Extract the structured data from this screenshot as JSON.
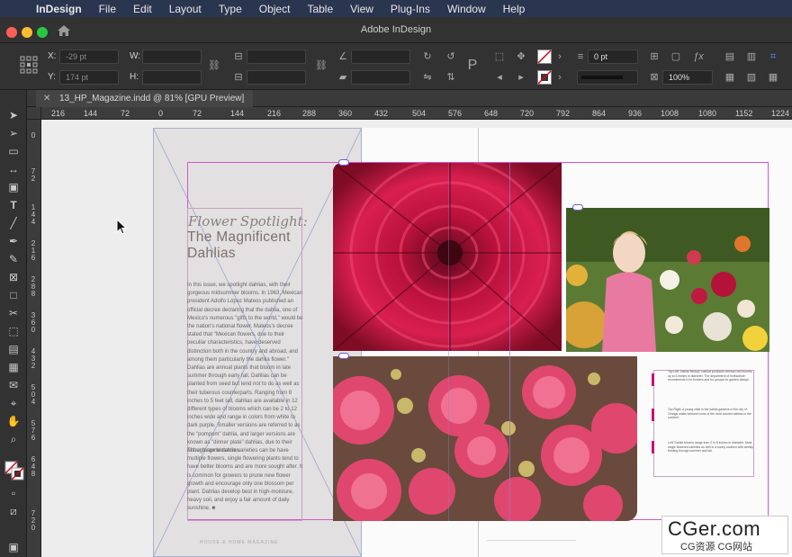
{
  "menubar": {
    "app": "InDesign",
    "items": [
      "File",
      "Edit",
      "Layout",
      "Type",
      "Object",
      "Table",
      "View",
      "Plug-Ins",
      "Window",
      "Help"
    ]
  },
  "window": {
    "title": "Adobe InDesign"
  },
  "control": {
    "x_label": "X:",
    "x_value": "-29 pt",
    "y_label": "Y:",
    "y_value": "174 pt",
    "w_label": "W:",
    "h_label": "H:",
    "stroke_weight": "0 pt",
    "zoom": "100%"
  },
  "document": {
    "tab_title": "13_HP_Magazine.indd @ 81% [GPU Preview]"
  },
  "ruler": {
    "horizontal": [
      "216",
      "144",
      "72",
      "0",
      "72",
      "144",
      "216",
      "288",
      "360",
      "432",
      "504",
      "576",
      "648",
      "720",
      "792",
      "864",
      "936",
      "1008",
      "1080",
      "1152",
      "1224"
    ],
    "vertical": [
      "0",
      "7 2",
      "1 4 4",
      "2 1 6",
      "2 8 8",
      "3 6 0",
      "4 3 2",
      "5 0 4",
      "5 7 6",
      "6 4 8",
      "7 2 0"
    ]
  },
  "article": {
    "kicker": "Flower Spotlight:",
    "title_line1": "The Magnificent",
    "title_line2": "Dahlias",
    "para1": "In this issue, we spotlight dahlias, with their gorgeous midsummer blooms. In 1963, Mexican president Adolfo López Mateos published an official decree declaring that the dahlia, one of Mexico's numerous \"gifts to the world,\" would be the nation's national flower. Mateos's decree stated that \"Mexican flowers, due to their peculiar characteristics, have deserved distinction both in the country and abroad, and among them particularly the dahlia flower.\"",
    "para2": "Dahlias are annual plants that bloom in late summer through early fall. Dahlias can be planted from seed but tend not to do as well as their tuberous counterparts. Ranging from 8 inches to 5 feet tall, dahlias are available in 12 different types of blooms which can be 2 to 12 inches wide and range in colors from white to dark purple. Smaller versions are referred to as the \"pompom\" dahlia, and larger versions are known as \"dinner plate\" dahlias, due to their rather large blossoms.",
    "para3": "Though some dahlia varieties can be have multiple flowers, single flowering plants tend to have better blooms and are more sought after. It is common for growers to prune new flower growth and encourage only one blossom per plant. Dahlias develop best in high-moisture, heavy soil, and enjoy a fair amount of daily sunshine. ■",
    "footer": "HOUSE & HOME MAGAZINE"
  },
  "captions": {
    "cap1": "Top Left: Dahlia 'Bishop' cultivar produces crimson red blooms up to 6 inches in diameter. The department of horticulture recommends it for borders and for groups for garden design.",
    "cap2": "Top Right: A young child in the dahlia gardens of the city of Orange walks between rows of the vivid colored dahlias in the summer.",
    "cap3": "Left: Dahlia blooms range from 2 to 8 inches in diameter. Most single flowered varieties do well in a sunny location with weekly feeding through summer and fall."
  },
  "watermark": {
    "brand": "CGer.com",
    "sub": "CG资源  CG网站"
  },
  "colors": {
    "accent": "#c7107a",
    "frame": "#d257c8",
    "menubar": "#2a3550"
  }
}
